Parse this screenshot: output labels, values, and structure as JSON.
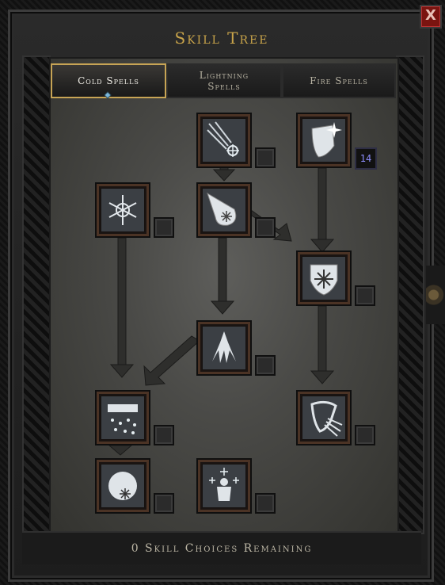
{
  "window": {
    "title": "Skill Tree",
    "close_glyph": "X"
  },
  "tabs": [
    {
      "label": "Cold Spells",
      "active": true
    },
    {
      "label": "Lightning Spells",
      "active": false
    },
    {
      "label": "Fire Spells",
      "active": false
    }
  ],
  "skills": [
    {
      "id": "ice-bolt",
      "icon": "ice-bolt-icon",
      "points": ""
    },
    {
      "id": "frozen-armor",
      "icon": "frozen-armor-icon",
      "points": "14"
    },
    {
      "id": "frost-nova",
      "icon": "frost-nova-icon",
      "points": ""
    },
    {
      "id": "ice-blast",
      "icon": "ice-blast-icon",
      "points": ""
    },
    {
      "id": "shiver-armor",
      "icon": "shiver-armor-icon",
      "points": ""
    },
    {
      "id": "glacial-spike",
      "icon": "glacial-spike-icon",
      "points": ""
    },
    {
      "id": "blizzard",
      "icon": "blizzard-icon",
      "points": ""
    },
    {
      "id": "chilling-armor",
      "icon": "chilling-armor-icon",
      "points": ""
    },
    {
      "id": "frozen-orb",
      "icon": "frozen-orb-icon",
      "points": ""
    },
    {
      "id": "cold-mastery",
      "icon": "cold-mastery-icon",
      "points": ""
    }
  ],
  "footer": {
    "text": "0 Skill Choices Remaining"
  },
  "colors": {
    "gold": "#c9a44a",
    "accent_blue": "#8e8eff",
    "panel": "#4a4a47"
  }
}
